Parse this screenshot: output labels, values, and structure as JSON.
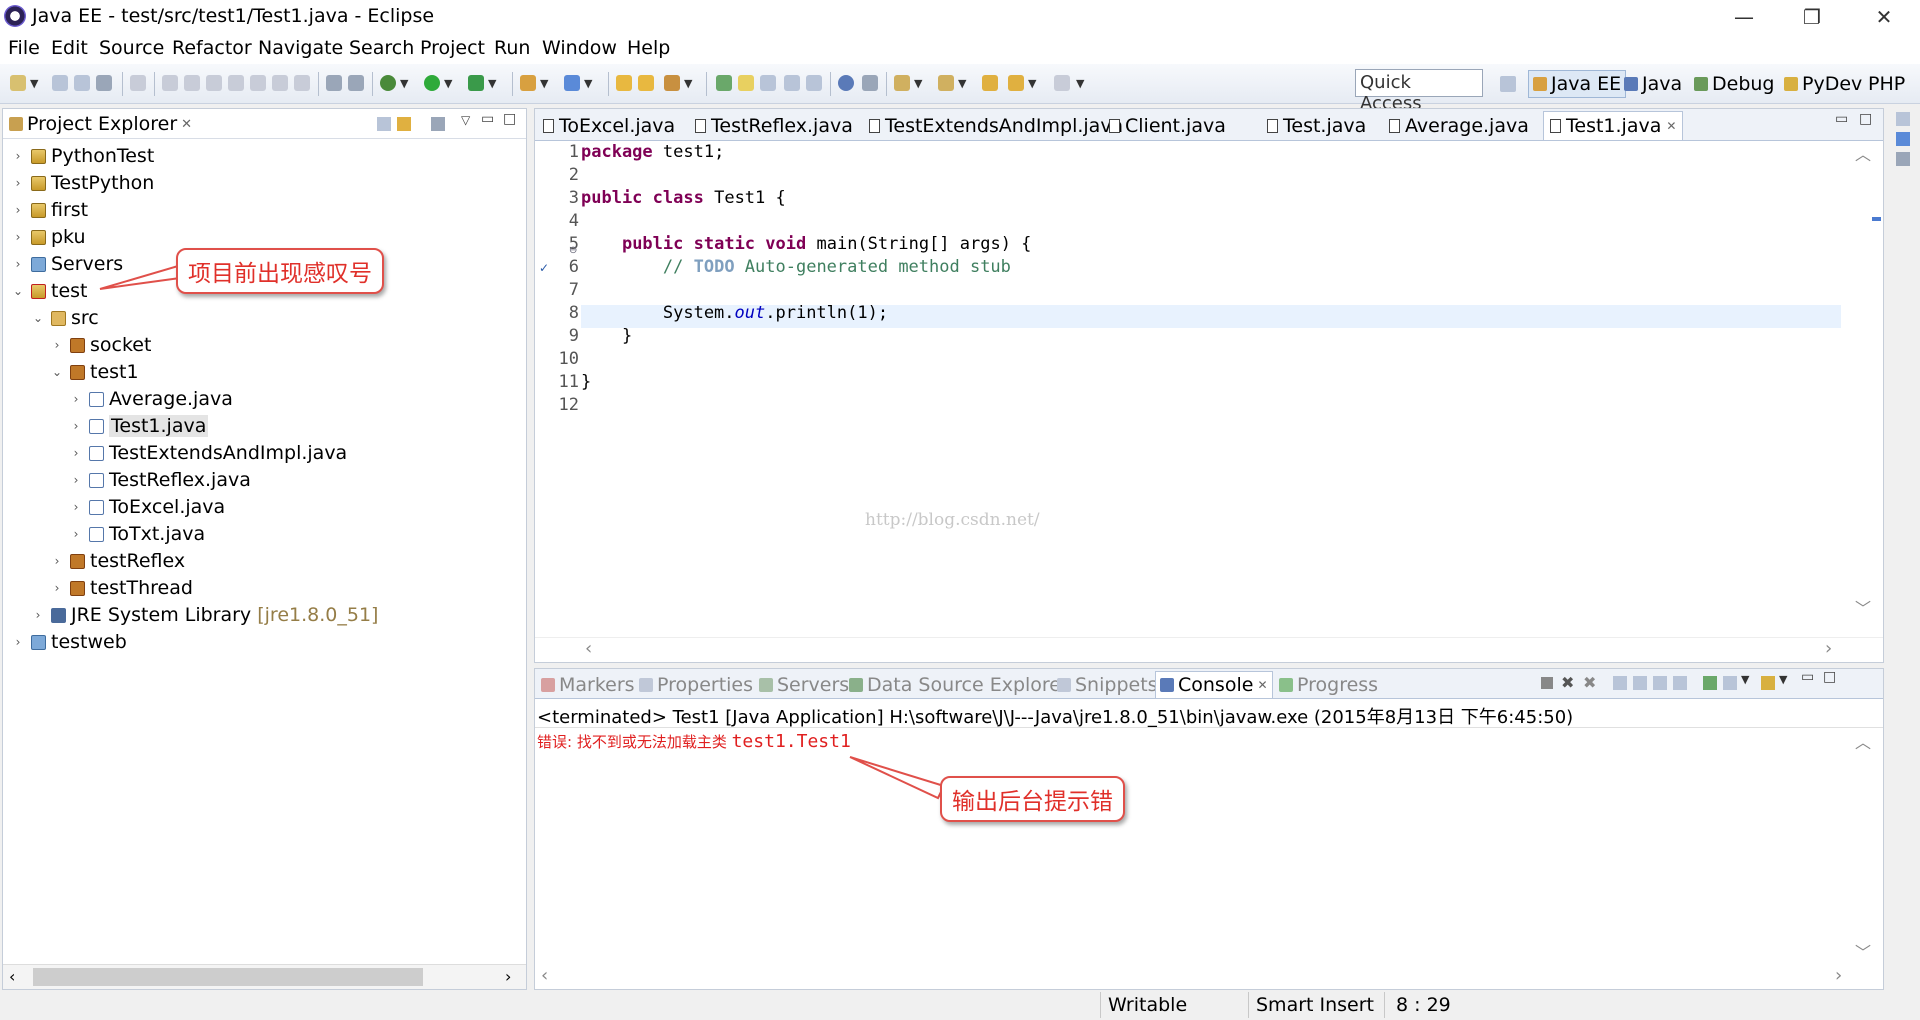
{
  "window": {
    "title": "Java EE - test/src/test1/Test1.java - Eclipse",
    "minimize": "—",
    "restore": "❐",
    "close": "✕"
  },
  "menu": [
    "File",
    "Edit",
    "Source",
    "Refactor",
    "Navigate",
    "Search",
    "Project",
    "Run",
    "Window",
    "Help"
  ],
  "toolbar": {
    "quick_access": "Quick Access",
    "perspectives": [
      "Java EE",
      "Java",
      "Debug",
      "PyDev",
      "PHP"
    ]
  },
  "project_explorer": {
    "title": "Project Explorer",
    "items": [
      {
        "label": "PythonTest",
        "decor": ""
      },
      {
        "label": "TestPython",
        "decor": ""
      },
      {
        "label": "first",
        "decor": ""
      },
      {
        "label": "pku",
        "decor": ""
      },
      {
        "label": "Servers",
        "decor": ""
      },
      {
        "label": "test",
        "decor": ""
      },
      {
        "label": "src",
        "decor": ""
      },
      {
        "label": "socket",
        "decor": ""
      },
      {
        "label": "test1",
        "decor": ""
      },
      {
        "label": "Average.java",
        "decor": ""
      },
      {
        "label": "Test1.java",
        "decor": ""
      },
      {
        "label": "TestExtendsAndImpl.java",
        "decor": ""
      },
      {
        "label": "TestReflex.java",
        "decor": ""
      },
      {
        "label": "ToExcel.java",
        "decor": ""
      },
      {
        "label": "ToTxt.java",
        "decor": ""
      },
      {
        "label": "testReflex",
        "decor": ""
      },
      {
        "label": "testThread",
        "decor": ""
      },
      {
        "label": "JRE System Library",
        "decor": "[jre1.8.0_51]"
      },
      {
        "label": "testweb",
        "decor": ""
      }
    ]
  },
  "editor": {
    "tabs": [
      "ToExcel.java",
      "TestReflex.java",
      "TestExtendsAndImpl.java",
      "Client.java",
      "Test.java",
      "Average.java",
      "Test1.java"
    ],
    "active_tab": "Test1.java",
    "line_numbers": [
      "1",
      "2",
      "3",
      "4",
      "5",
      "6",
      "7",
      "8",
      "9",
      "10",
      "11",
      "12"
    ]
  },
  "console": {
    "tabs": [
      "Markers",
      "Properties",
      "Servers",
      "Data Source Explorer",
      "Snippets",
      "Console",
      "Progress"
    ],
    "active_tab": "Console",
    "terminated": "<terminated> Test1 [Java Application] H:\\software\\J\\J---Java\\jre1.8.0_51\\bin\\javaw.exe (2015年8月13日 下午6:45:50)",
    "error_prefix": "错误: 找不到或无法加载主类 ",
    "error_class": "test1.Test1"
  },
  "status": {
    "writable": "Writable",
    "insert_mode": "Smart Insert",
    "position": "8 : 29"
  },
  "annotations": {
    "tree_note": "项目前出现感叹号",
    "console_note": "输出后台提示错"
  },
  "watermark": "http://blog.csdn.net/",
  "colors": {
    "keyword": "#7f0055",
    "comment": "#3f7f5f",
    "error": "#e02020",
    "callout": "#e0504a"
  }
}
